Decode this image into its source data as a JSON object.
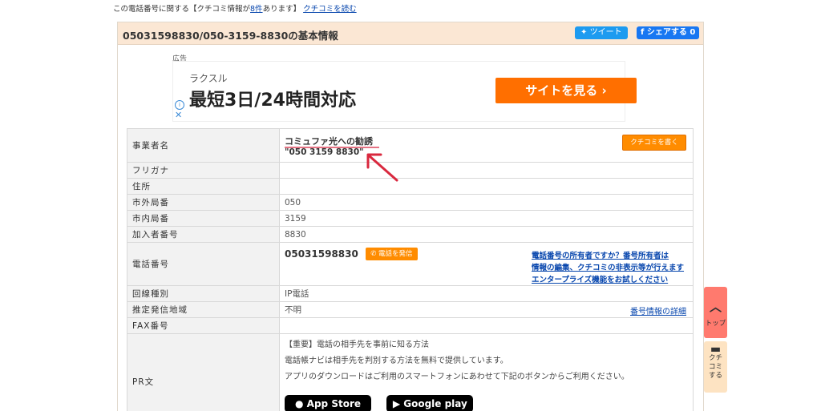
{
  "top_notice": {
    "prefix": "この電話番号に関する【クチコミ情報が",
    "count": "8件",
    "suffix": "あります】",
    "link": "クチコミを読む"
  },
  "panel": {
    "title": "05031598830/050-3159-8830の基本情報",
    "tweet": "ツイート",
    "share": "シェアする 0"
  },
  "ad": {
    "label": "広告",
    "brand": "ラクスル",
    "headline": "最短3日/24時間対応",
    "cta": "サイトを見る ›",
    "info_icon": "i",
    "close_icon": "✕"
  },
  "table": {
    "labels": [
      "事業者名",
      "フリガナ",
      "住所",
      "市外局番",
      "市内局番",
      "加入者番号",
      "電話番号",
      "回線種別",
      "推定発信地域",
      "FAX番号",
      "PR文"
    ],
    "business_name": "コミュファ光への勧誘",
    "business_number": "\"050 3159 8830\"",
    "kuchikomi_button": "クチコミを書く",
    "area_code": "050",
    "local_code": "3159",
    "subscriber": "8830",
    "phone": "05031598830",
    "call_button": "電話を発信",
    "owner_links": [
      "電話番号の所有者ですか？番号所有者は",
      "情報の編集、クチコミの非表示等が行えます",
      "エンタープライズ機能をお試しください"
    ],
    "line_type": "IP電話",
    "region": "不明",
    "detail_link": "番号情報の詳細",
    "pr": [
      "【重要】電話の相手先を事前に知る方法",
      "電話帳ナビは相手先を判別する方法を無料で提供しています。",
      "アプリのダウンロードはご利用のスマートフォンにあわせて下記のボタンからご利用ください。"
    ],
    "app_store": "App Store",
    "google_play": "Google play"
  },
  "side": {
    "top": "トップ",
    "kuchikomi": [
      "クチ",
      "コミ",
      "する"
    ]
  },
  "colors": {
    "accent": "#ff8c00",
    "header_bg": "#fbe7d4",
    "link": "#0645ad",
    "annotation": "#d9283e"
  }
}
